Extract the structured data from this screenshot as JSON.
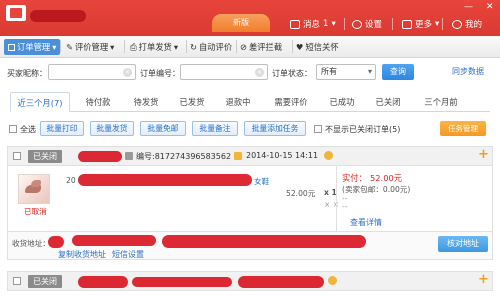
{
  "titlebar": {
    "version_label": "新版",
    "messages_label": "消息",
    "messages_count": "1",
    "settings_label": "设置",
    "more_label": "更多",
    "user_label": "我的",
    "brand_color": "#e8453c"
  },
  "toolbar": {
    "items": [
      "订单管理",
      "评价管理",
      "打单发货",
      "自动评价",
      "差评拦截",
      "短信关怀"
    ]
  },
  "search": {
    "buyer_label": "买家昵称：",
    "order_label": "订单编号：",
    "status_label": "订单状态：",
    "status_value": "所有",
    "search_button": "查询",
    "sync_link": "同步数据"
  },
  "tabs": [
    "近三个月(7)",
    "待付款",
    "待发货",
    "已发货",
    "退款中",
    "需要评价",
    "已成功",
    "已关闭",
    "三个月前"
  ],
  "actions": {
    "select_all": "全选",
    "buttons": [
      "批量打印",
      "批量发货",
      "批量免邮",
      "批量备注",
      "批量添加任务"
    ],
    "hide_closed": "不显示已关闭订单(5)",
    "task_button": "任务管理"
  },
  "order1": {
    "status": "已关闭",
    "order_no": "编号:817274396583562",
    "date": "2014-10-15 14:11",
    "item_prefix": "20",
    "item_suffix": "女鞋",
    "item_status": "已取消",
    "unit_price": "52.00元",
    "qty": "x 1",
    "paid_label": "实付：",
    "paid_value": "52.00元",
    "shipping": "(卖家包邮：0.00元)",
    "detail_link": "查看详情",
    "address_label": "收货地址：",
    "copy_link": "复制收货地址",
    "sms_link": "短信设置",
    "verify_button": "核对地址"
  },
  "order2": {
    "status": "已关闭"
  }
}
